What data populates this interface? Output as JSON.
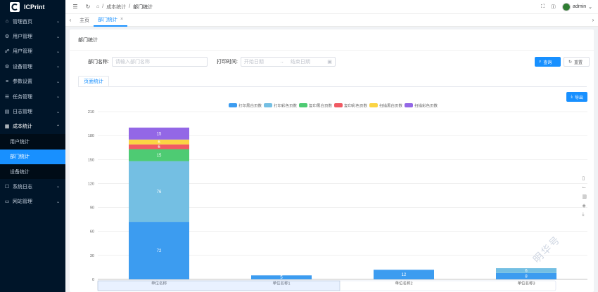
{
  "app": {
    "name": "ICPrint"
  },
  "sidebar": {
    "items": [
      {
        "label": "管理首页",
        "icon": "home-icon"
      },
      {
        "label": "用户管理",
        "icon": "users-icon"
      },
      {
        "label": "用户管理",
        "icon": "user-group-icon"
      },
      {
        "label": "设备管理",
        "icon": "device-icon"
      },
      {
        "label": "参数设置",
        "icon": "settings-icon"
      },
      {
        "label": "任务管理",
        "icon": "task-icon"
      },
      {
        "label": "日志管理",
        "icon": "log-icon"
      },
      {
        "label": "成本统计",
        "icon": "stats-icon"
      }
    ],
    "subitems": [
      {
        "label": "用户统计"
      },
      {
        "label": "部门统计"
      },
      {
        "label": "设备统计"
      }
    ],
    "bottom_items": [
      {
        "label": "系统日志",
        "icon": "system-log-icon"
      },
      {
        "label": "网站管理",
        "icon": "website-icon"
      }
    ]
  },
  "header": {
    "breadcrumb": [
      "成本统计",
      "部门统计"
    ],
    "user": "admin"
  },
  "tabs": [
    {
      "label": "主页"
    },
    {
      "label": "部门统计"
    }
  ],
  "page": {
    "title": "部门统计",
    "dept_label": "部门名称:",
    "dept_placeholder": "请输入部门名称",
    "time_label": "打印时间:",
    "start_placeholder": "开始日期",
    "range_sep": "→",
    "end_placeholder": "结束日期",
    "search_label": "查询",
    "reset_label": "重置",
    "subtab": "页面统计",
    "export_label": "导出",
    "watermark": "明华号"
  },
  "chart_data": {
    "type": "bar",
    "stacked": true,
    "categories": [
      "单位名称",
      "单位名称1",
      "单位名称2",
      "单位名称3"
    ],
    "ylim": [
      0,
      210
    ],
    "yticks": [
      0,
      30,
      60,
      90,
      120,
      150,
      180,
      210
    ],
    "legend_position": "top",
    "series": [
      {
        "name": "打印黑白页数",
        "color": "#3c9cf0",
        "values": [
          72,
          5,
          12,
          8
        ]
      },
      {
        "name": "打印彩色页数",
        "color": "#74bfe3",
        "values": [
          76,
          0,
          0,
          6
        ]
      },
      {
        "name": "复印黑白页数",
        "color": "#4ecb73",
        "values": [
          15,
          0,
          0,
          0
        ]
      },
      {
        "name": "复印彩色页数",
        "color": "#f05a63",
        "values": [
          6,
          0,
          0,
          0
        ]
      },
      {
        "name": "扫描黑白页数",
        "color": "#fbd444",
        "values": [
          6,
          0,
          0,
          0
        ]
      },
      {
        "name": "扫描彩色页数",
        "color": "#9367e6",
        "values": [
          15,
          0,
          0,
          0
        ]
      }
    ]
  }
}
